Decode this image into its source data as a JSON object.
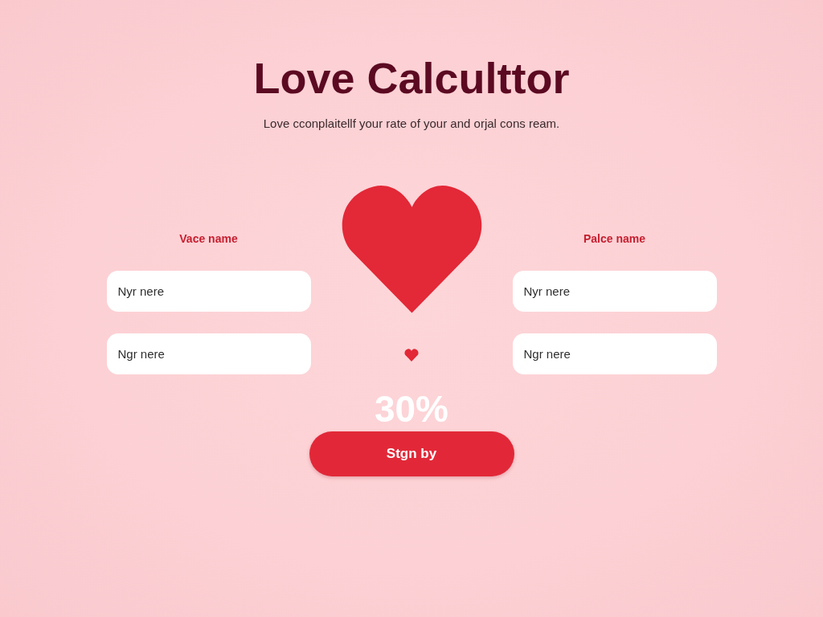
{
  "header": {
    "title": "Love Calculttor",
    "subtitle": "Love cconplaitellf your rate of your and orjal cons ream."
  },
  "partners": [
    {
      "label": "Vace name",
      "fields": [
        {
          "placeholder": "Nyr nere"
        },
        {
          "placeholder": "Ngr nere"
        }
      ]
    },
    {
      "label": "Palce name",
      "fields": [
        {
          "placeholder": "Nyr nere"
        },
        {
          "placeholder": "Ngr nere"
        }
      ]
    }
  ],
  "result": {
    "percent": "30%"
  },
  "button": {
    "label": "Stgn by"
  }
}
